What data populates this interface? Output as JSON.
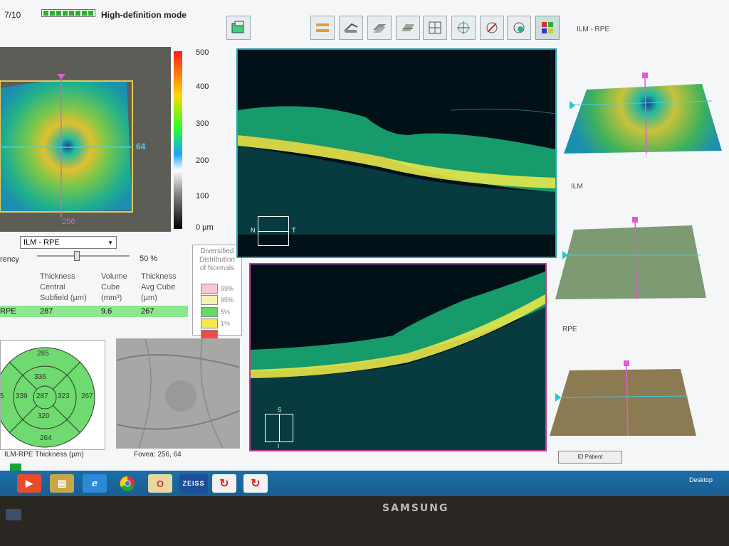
{
  "header": {
    "page_count": "7/10",
    "hd_label": "High-definition mode",
    "right_top_label": "ILM - RPE"
  },
  "toolbar": {
    "icons": [
      "export-icon",
      "line-scan-icon",
      "layer-move-icon",
      "volume-icon",
      "layer-stack-icon",
      "crosshair-icon",
      "crosshair-target-icon",
      "probe-icon",
      "registration-icon",
      "thickness-map-icon"
    ]
  },
  "thickness_map": {
    "scale_labels": [
      "500",
      "400",
      "300",
      "200",
      "100",
      "0 µm"
    ],
    "crosshair_x_label": "256",
    "crosshair_y_label": "64"
  },
  "controls": {
    "layer_select": "ILM - RPE",
    "transparency_label": "rency",
    "transparency_value": "50 %"
  },
  "table": {
    "col1": [
      "Thickness",
      "Central",
      "Subfield (µm)"
    ],
    "col2": [
      "Volume",
      "Cube",
      "(mm³)"
    ],
    "col3": [
      "Thickness",
      "Avg Cube",
      "(µm)"
    ],
    "row_label": "RPE",
    "values": [
      "287",
      "9.6",
      "267"
    ]
  },
  "normals": {
    "title": [
      "Diversified",
      "Distribution",
      "of Normals"
    ],
    "items": [
      {
        "label": "99%",
        "color": "#f7c6cf"
      },
      {
        "label": "95%",
        "color": "#f6f2b0"
      },
      {
        "label": "5%",
        "color": "#66d966"
      },
      {
        "label": "1%",
        "color": "#f7e84a"
      },
      {
        "label": "",
        "color": "#ee4c4c"
      }
    ]
  },
  "etdrs": {
    "values": {
      "outer_top": "285",
      "inner_top": "336",
      "outer_left": "5",
      "inner_left": "339",
      "center": "287",
      "inner_right": "323",
      "outer_right": "267",
      "inner_bottom": "320",
      "outer_bottom": "264"
    },
    "caption": "ILM-RPE Thickness (µm)"
  },
  "fundus": {
    "caption": "Fovea:  256, 64"
  },
  "scan_orientation": {
    "n": "N",
    "t": "T",
    "s": "S",
    "i": "I"
  },
  "surfaces": {
    "labels": [
      "ILM",
      "RPE"
    ]
  },
  "id_button": "ID Patient",
  "taskbar": {
    "desktop_label": "Desktop",
    "zeiss_label": "ZEISS"
  },
  "monitor": {
    "brand": "SAMSUNG"
  }
}
